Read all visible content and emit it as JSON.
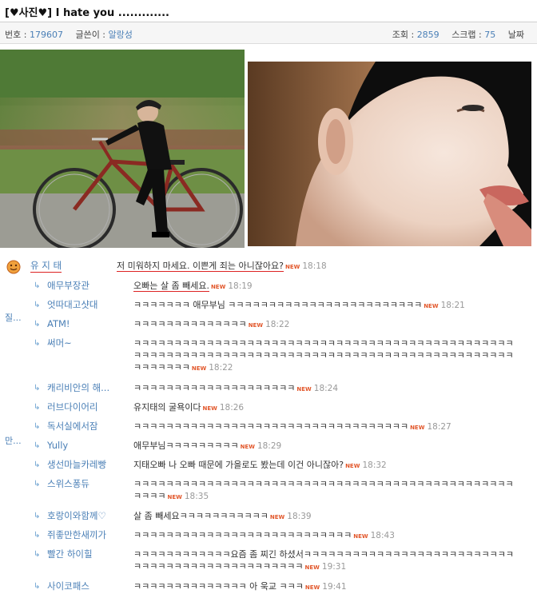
{
  "post": {
    "title": "[♥사진♥] I hate you .............",
    "number_label": "번호 :",
    "number_value": "179607",
    "author_label": "글쓴이 :",
    "author_value": "알랑성",
    "views_label": "조회 :",
    "views_value": "2859",
    "scrap_label": "스크랩 :",
    "scrap_value": "75",
    "date_label": "날짜"
  },
  "side_labels": [
    "질...",
    "만..."
  ],
  "new_badge": "NEW",
  "comments": [
    {
      "nick": "유 지 태",
      "text": "저 미워하지 마세요. 이쁜게 죄는 아니잖아요?",
      "time": "18:18"
    },
    {
      "nick": "애무부장관",
      "text": "오빠는 살 좀 빼세요.",
      "time": "18:19"
    },
    {
      "nick": "엇따대고샷대",
      "text": "ㅋㅋㅋㅋㅋㅋㅋ 애무부님 ㅋㅋㅋㅋㅋㅋㅋㅋㅋㅋㅋㅋㅋㅋㅋㅋㅋㅋㅋㅋㅋㅋㅋㅋ",
      "time": "18:21"
    },
    {
      "nick": "ATM!",
      "text": "ㅋㅋㅋㅋㅋㅋㅋㅋㅋㅋㅋㅋㅋㅋ",
      "time": "18:22"
    },
    {
      "nick": "써머~",
      "text": "ㅋㅋㅋㅋㅋㅋㅋㅋㅋㅋㅋㅋㅋㅋㅋㅋㅋㅋㅋㅋㅋㅋㅋㅋㅋㅋㅋㅋㅋㅋㅋㅋㅋㅋㅋㅋㅋㅋㅋㅋㅋㅋㅋㅋㅋㅋㅋㅋㅋㅋㅋㅋㅋㅋㅋㅋㅋㅋㅋㅋㅋㅋㅋㅋㅋㅋㅋㅋㅋㅋㅋㅋㅋㅋㅋㅋㅋㅋㅋㅋㅋㅋㅋㅋㅋㅋㅋㅋㅋㅋㅋㅋㅋㅋㅋㅋㅋㅋㅋㅋㅋ",
      "time": "18:22"
    },
    {
      "nick": "캐리비안의 해...",
      "text": "ㅋㅋㅋㅋㅋㅋㅋㅋㅋㅋㅋㅋㅋㅋㅋㅋㅋㅋㅋㅋ",
      "time": "18:24"
    },
    {
      "nick": "러브다이어리",
      "text": "유지태의 굴욕이다",
      "time": "18:26"
    },
    {
      "nick": "독서실에서잠",
      "text": "ㅋㅋㅋㅋㅋㅋㅋㅋㅋㅋㅋㅋㅋㅋㅋㅋㅋㅋㅋㅋㅋㅋㅋㅋㅋㅋㅋㅋㅋㅋㅋㅋㅋㅋ",
      "time": "18:27"
    },
    {
      "nick": "Yully",
      "text": "애무부님ㅋㅋㅋㅋㅋㅋㅋㅋㅋ",
      "time": "18:29"
    },
    {
      "nick": "생선마늘카레빵",
      "text": "지태오빠 나 오빠 때문에 가을로도 봤는데 이건 아니잖아?",
      "time": "18:32"
    },
    {
      "nick": "스위스퐁듀",
      "text": "ㅋㅋㅋㅋㅋㅋㅋㅋㅋㅋㅋㅋㅋㅋㅋㅋㅋㅋㅋㅋㅋㅋㅋㅋㅋㅋㅋㅋㅋㅋㅋㅋㅋㅋㅋㅋㅋㅋㅋㅋㅋㅋㅋㅋㅋㅋㅋㅋㅋㅋㅋ",
      "time": "18:35"
    },
    {
      "nick": "호랑이와함께♡",
      "text": "살 좀 빼세요ㅋㅋㅋㅋㅋㅋㅋㅋㅋㅋㅋ",
      "time": "18:39"
    },
    {
      "nick": "쥐좋만한새끼가",
      "text": "ㅋㅋㅋㅋㅋㅋㅋㅋㅋㅋㅋㅋㅋㅋㅋㅋㅋㅋㅋㅋㅋㅋㅋㅋㅋㅋㅋ",
      "time": "18:43"
    },
    {
      "nick": "빨간 하이힐",
      "text": "ㅋㅋㅋㅋㅋㅋㅋㅋㅋㅋㅋㅋ요즘 좀 찌긴 하셨서ㅋㅋㅋㅋㅋㅋㅋㅋㅋㅋㅋㅋㅋㅋㅋㅋㅋㅋㅋㅋㅋㅋㅋㅋㅋㅋㅋㅋㅋㅋㅋㅋㅋㅋㅋㅋㅋㅋㅋㅋㅋㅋㅋㅋㅋㅋㅋ",
      "time": "19:31"
    },
    {
      "nick": "사이코패스",
      "text": "ㅋㅋㅋㅋㅋㅋㅋㅋㅋㅋㅋㅋㅋㅋ 아 욱교 ㅋㅋㅋ",
      "time": "19:41"
    }
  ]
}
